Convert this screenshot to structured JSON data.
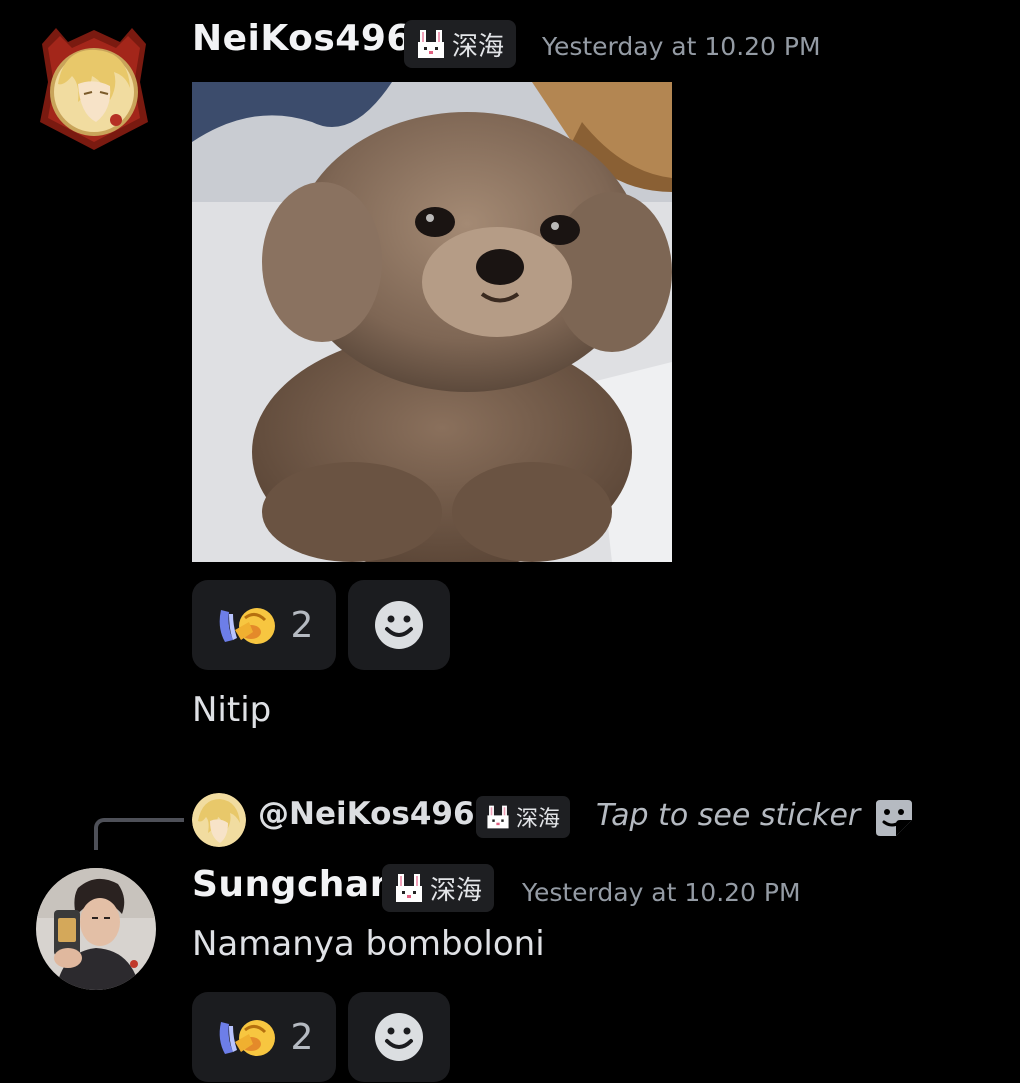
{
  "messages": [
    {
      "author": "NeiKos496",
      "tag_text": "深海",
      "timestamp": "Yesterday at 10.20 PM",
      "attachment_icon": "poodle-photo",
      "reactions": {
        "emoji_icon": "pray-emoji",
        "count": "2",
        "add_icon": "add-reaction-icon"
      }
    },
    {
      "text": "Nitip"
    },
    {
      "reply_to": {
        "mention": "@NeiKos496",
        "tag_text": "深海",
        "preview": "Tap to see sticker",
        "icon": "sticker-icon"
      },
      "author": "Sungchan",
      "tag_text": "深海",
      "timestamp": "Yesterday at 10.20 PM",
      "text": "Namanya bomboloni",
      "reactions": {
        "emoji_icon": "pray-emoji",
        "count": "2",
        "add_icon": "add-reaction-icon"
      }
    }
  ],
  "colors": {
    "background": "#000000",
    "tag_bg": "#1e1f22",
    "reaction_bg": "#1b1c1f",
    "timestamp": "#949ba4",
    "text": "#dfe1e5"
  }
}
